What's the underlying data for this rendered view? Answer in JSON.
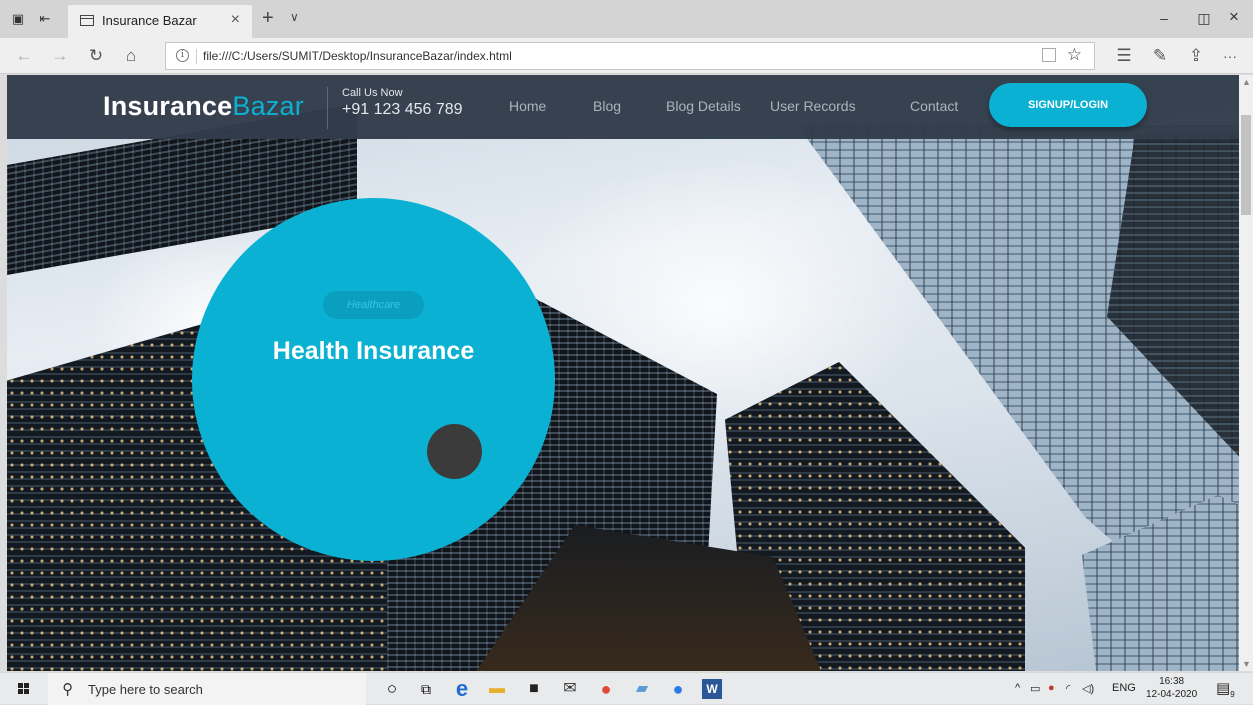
{
  "browser": {
    "tab_title": "Insurance Bazar",
    "tab_close": "×",
    "new_tab": "+",
    "tab_menu": "∨",
    "url": "file:///C:/Users/SUMIT/Desktop/InsuranceBazar/index.html",
    "window_minimize": "–",
    "window_restore": "◫",
    "window_close": "×",
    "more": "···"
  },
  "site": {
    "brand_bold": "Insurance",
    "brand_light": "Bazar",
    "call_label": "Call Us Now",
    "call_number": "+91 123 456 789",
    "nav": [
      "Home",
      "Blog",
      "Blog Details",
      "User Records",
      "Contact"
    ],
    "signup_label": "SIGNUP/LOGIN",
    "accent_color": "#0bb1d3",
    "header_color": "#323c4a"
  },
  "hero": {
    "badge": "Healthcare",
    "title": "Health Insurance"
  },
  "taskbar": {
    "search_placeholder": "Type here to search",
    "language": "ENG",
    "time": "16:38",
    "date": "12-04-2020",
    "notification_count": "9"
  }
}
